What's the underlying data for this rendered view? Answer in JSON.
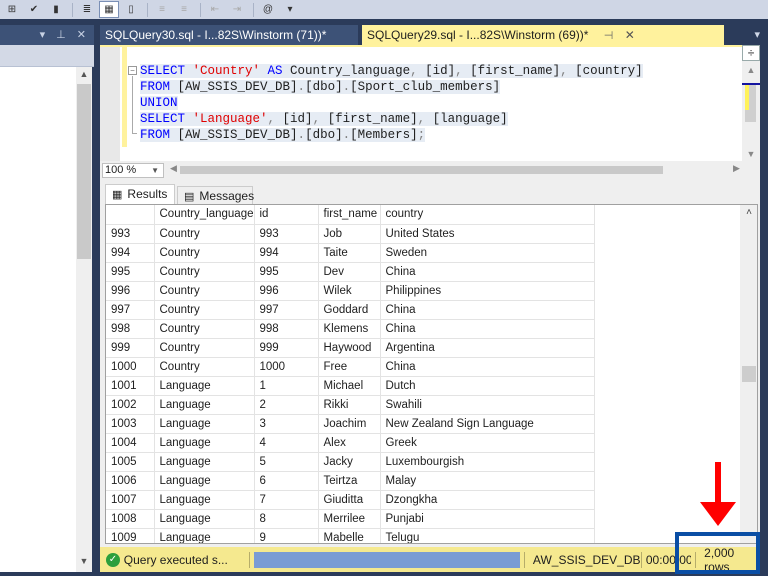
{
  "toolbar": {
    "buttons": [
      {
        "icon": "connect-icon"
      },
      {
        "icon": "check-connect-icon"
      },
      {
        "icon": "query-options-icon"
      },
      {
        "icon": "results-to-text-icon"
      },
      {
        "icon": "results-to-grid-icon",
        "active": true
      },
      {
        "icon": "results-to-file-icon"
      },
      {
        "icon": "comment-icon",
        "disabled": true
      },
      {
        "icon": "uncomment-icon",
        "disabled": true
      },
      {
        "icon": "decrease-indent-icon",
        "disabled": true
      },
      {
        "icon": "increase-indent-icon",
        "disabled": true
      },
      {
        "icon": "specify-values-icon"
      }
    ],
    "overflow": "▾"
  },
  "left_panel": {
    "controls": "▾ ⊥ ✕"
  },
  "tabs": [
    {
      "label": "SQLQuery30.sql - I...82S\\Winstorm (71))*",
      "active": false
    },
    {
      "label": "SQLQuery29.sql - I...82S\\Winstorm (69))*",
      "active": true
    }
  ],
  "tab_pin": "⊣",
  "tab_close": "✕",
  "editor": {
    "lines": [
      [
        {
          "t": "SELECT ",
          "c": "kw"
        },
        {
          "t": "'Country'",
          "c": "str"
        },
        {
          "t": " AS ",
          "c": "kw"
        },
        {
          "t": "Country_language",
          "c": ""
        },
        {
          "t": ", ",
          "c": "gray"
        },
        {
          "t": "[id]",
          "c": ""
        },
        {
          "t": ", ",
          "c": "gray"
        },
        {
          "t": "[first_name]",
          "c": ""
        },
        {
          "t": ", ",
          "c": "gray"
        },
        {
          "t": "[country]",
          "c": ""
        }
      ],
      [
        {
          "t": "FROM ",
          "c": "kw"
        },
        {
          "t": "[AW_SSIS_DEV_DB]",
          "c": ""
        },
        {
          "t": ".",
          "c": "gray"
        },
        {
          "t": "[dbo]",
          "c": ""
        },
        {
          "t": ".",
          "c": "gray"
        },
        {
          "t": "[Sport_club_members]",
          "c": ""
        }
      ],
      [
        {
          "t": "UNION",
          "c": "kw"
        }
      ],
      [
        {
          "t": "SELECT ",
          "c": "kw"
        },
        {
          "t": "'Language'",
          "c": "str"
        },
        {
          "t": ", ",
          "c": "gray"
        },
        {
          "t": "[id]",
          "c": ""
        },
        {
          "t": ", ",
          "c": "gray"
        },
        {
          "t": "[first_name]",
          "c": ""
        },
        {
          "t": ", ",
          "c": "gray"
        },
        {
          "t": "[language]",
          "c": ""
        }
      ],
      [
        {
          "t": "FROM ",
          "c": "kw"
        },
        {
          "t": "[AW_SSIS_DEV_DB]",
          "c": ""
        },
        {
          "t": ".",
          "c": "gray"
        },
        {
          "t": "[dbo]",
          "c": ""
        },
        {
          "t": ".",
          "c": "gray"
        },
        {
          "t": "[Members]",
          "c": ""
        },
        {
          "t": ";",
          "c": "gray"
        }
      ]
    ]
  },
  "zoom": {
    "value": "100 %"
  },
  "results_tabs": {
    "results": "Results",
    "messages": "Messages"
  },
  "grid": {
    "columns": [
      "",
      "Country_language",
      "id",
      "first_name",
      "country"
    ],
    "rows": [
      [
        "993",
        "Country",
        "993",
        "Job",
        "United States"
      ],
      [
        "994",
        "Country",
        "994",
        "Taite",
        "Sweden"
      ],
      [
        "995",
        "Country",
        "995",
        "Dev",
        "China"
      ],
      [
        "996",
        "Country",
        "996",
        "Wilek",
        "Philippines"
      ],
      [
        "997",
        "Country",
        "997",
        "Goddard",
        "China"
      ],
      [
        "998",
        "Country",
        "998",
        "Klemens",
        "China"
      ],
      [
        "999",
        "Country",
        "999",
        "Haywood",
        "Argentina"
      ],
      [
        "1000",
        "Country",
        "1000",
        "Free",
        "China"
      ],
      [
        "1001",
        "Language",
        "1",
        "Michael",
        "Dutch"
      ],
      [
        "1002",
        "Language",
        "2",
        "Rikki",
        "Swahili"
      ],
      [
        "1003",
        "Language",
        "3",
        "Joachim",
        "New Zealand Sign Language"
      ],
      [
        "1004",
        "Language",
        "4",
        "Alex",
        "Greek"
      ],
      [
        "1005",
        "Language",
        "5",
        "Jacky",
        "Luxembourgish"
      ],
      [
        "1006",
        "Language",
        "6",
        "Teirtza",
        "Malay"
      ],
      [
        "1007",
        "Language",
        "7",
        "Giuditta",
        "Dzongkha"
      ],
      [
        "1008",
        "Language",
        "8",
        "Merrilee",
        "Punjabi"
      ],
      [
        "1009",
        "Language",
        "9",
        "Mabelle",
        "Telugu"
      ]
    ]
  },
  "status": {
    "message": "Query executed s...",
    "database": "AW_SSIS_DEV_DB",
    "elapsed": "00:00:00",
    "rows": "2,000 rows"
  },
  "colors": {
    "active_tab": "#fff29d",
    "status_bar": "#f5e98f",
    "highlight_box": "#0a4ea5",
    "annotation_arrow": "#ff0000"
  }
}
